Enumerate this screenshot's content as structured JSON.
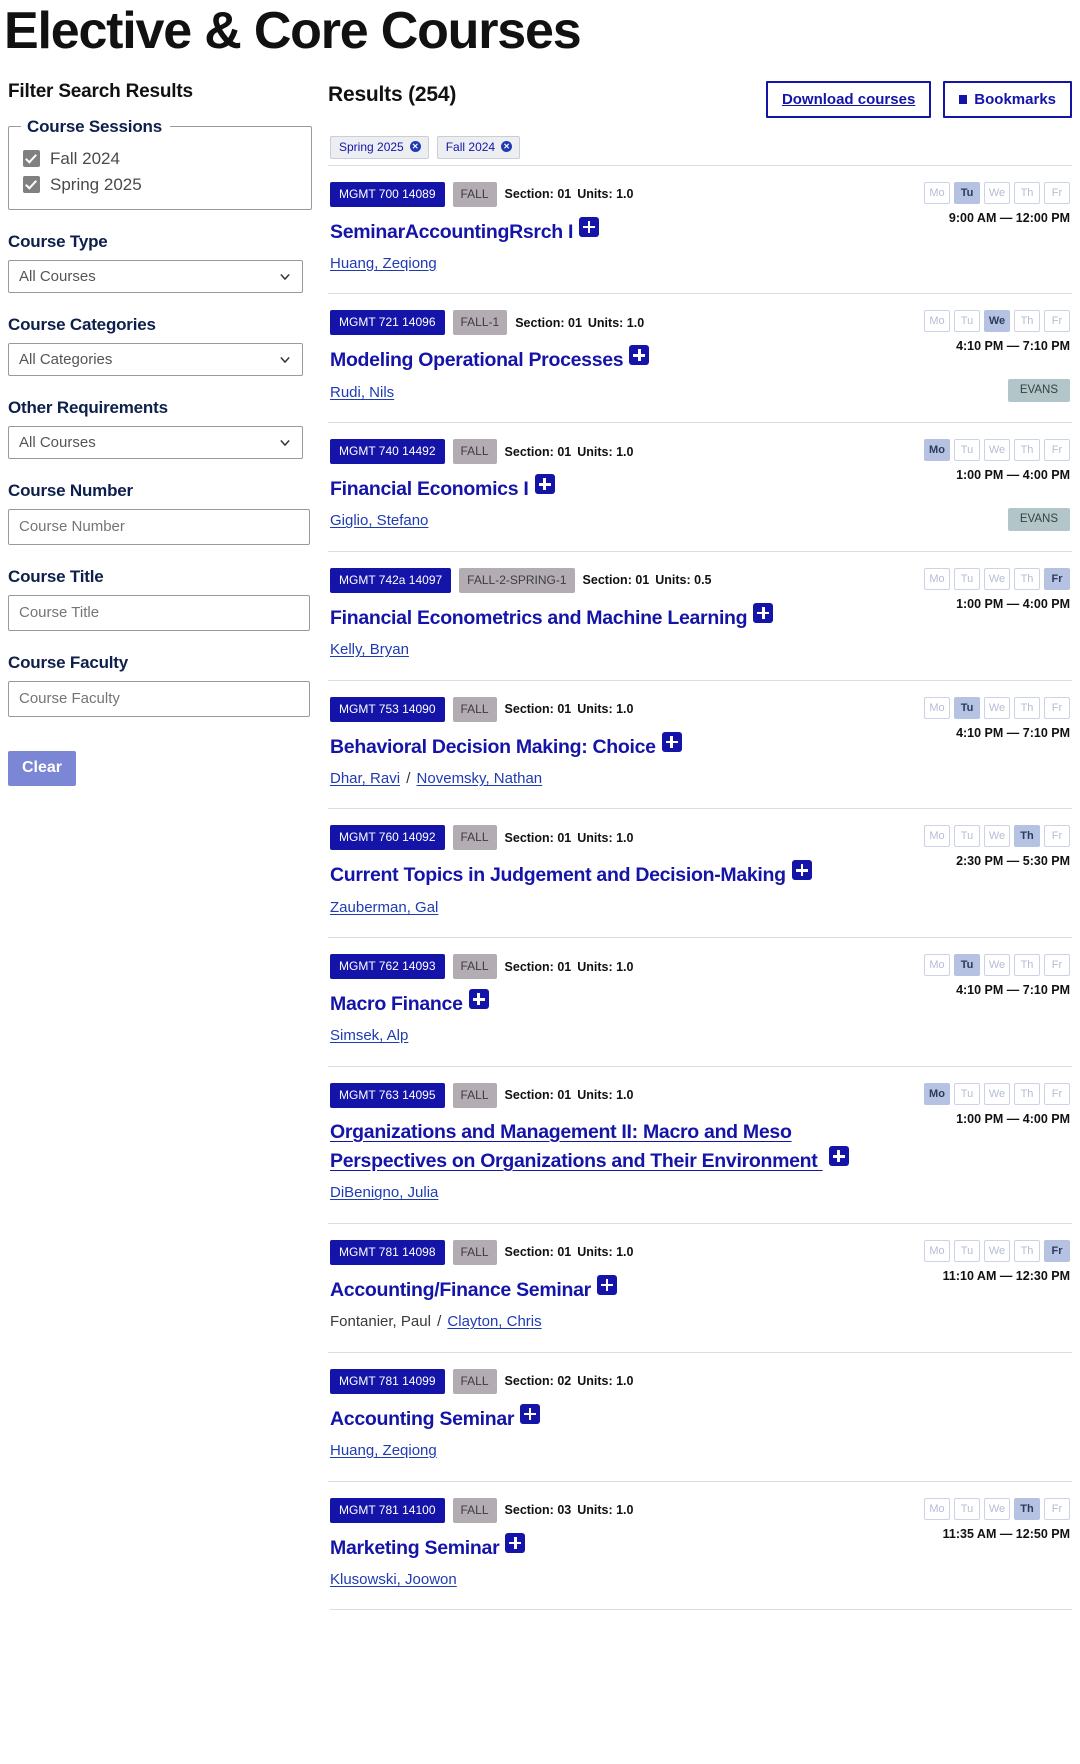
{
  "page_title": "Elective & Core Courses",
  "colors": {
    "brand_blue": "#1414a8",
    "navy": "#0d1f4a",
    "clear_button": "#7b87d4",
    "day_active": "#b6c2e2",
    "location_badge": "#b2c6c9",
    "term_badge": "#b3adb3"
  },
  "sidebar": {
    "heading": "Filter Search Results",
    "sessions": {
      "legend": "Course Sessions",
      "options": [
        {
          "label": "Fall 2024",
          "checked": true
        },
        {
          "label": "Spring 2025",
          "checked": true
        }
      ]
    },
    "course_type": {
      "label": "Course Type",
      "value": "All Courses"
    },
    "course_categories": {
      "label": "Course Categories",
      "value": "All Categories"
    },
    "other_requirements": {
      "label": "Other Requirements",
      "value": "All Courses"
    },
    "course_number": {
      "label": "Course Number",
      "placeholder": "Course Number",
      "value": ""
    },
    "course_title": {
      "label": "Course Title",
      "placeholder": "Course Title",
      "value": ""
    },
    "course_faculty": {
      "label": "Course Faculty",
      "placeholder": "Course Faculty",
      "value": ""
    },
    "clear_label": "Clear"
  },
  "results": {
    "count_label": "Results (254)",
    "download_label": "Download courses",
    "bookmarks_label": "Bookmarks",
    "chips": [
      {
        "label": "Spring 2025"
      },
      {
        "label": "Fall 2024"
      }
    ],
    "day_labels": [
      "Mo",
      "Tu",
      "We",
      "Th",
      "Fr"
    ],
    "courses": [
      {
        "code": "MGMT 700 14089",
        "term": "FALL",
        "section": "Section: 01",
        "units": "Units: 1.0",
        "title": "SeminarAccountingRsrch I",
        "title_underlined": false,
        "faculty": [
          {
            "name": "Huang, Zeqiong",
            "link": true
          }
        ],
        "days": [
          "Tu"
        ],
        "time": "9:00 AM — 12:00 PM",
        "location": ""
      },
      {
        "code": "MGMT 721 14096",
        "term": "FALL-1",
        "section": "Section: 01",
        "units": "Units: 1.0",
        "title": "Modeling Operational Processes",
        "title_underlined": false,
        "faculty": [
          {
            "name": "Rudi, Nils",
            "link": true
          }
        ],
        "days": [
          "We"
        ],
        "time": "4:10 PM — 7:10 PM",
        "location": "EVANS"
      },
      {
        "code": "MGMT 740 14492",
        "term": "FALL",
        "section": "Section: 01",
        "units": "Units: 1.0",
        "title": "Financial Economics I",
        "title_underlined": false,
        "faculty": [
          {
            "name": "Giglio, Stefano",
            "link": true
          }
        ],
        "days": [
          "Mo"
        ],
        "time": "1:00 PM — 4:00 PM",
        "location": "EVANS"
      },
      {
        "code": "MGMT 742a 14097",
        "term": "FALL-2-SPRING-1",
        "section": "Section: 01",
        "units": "Units: 0.5",
        "title": "Financial Econometrics and Machine Learning",
        "title_underlined": false,
        "faculty": [
          {
            "name": "Kelly, Bryan",
            "link": true
          }
        ],
        "days": [
          "Fr"
        ],
        "time": "1:00 PM — 4:00 PM",
        "location": ""
      },
      {
        "code": "MGMT 753 14090",
        "term": "FALL",
        "section": "Section: 01",
        "units": "Units: 1.0",
        "title": "Behavioral Decision Making: Choice",
        "title_underlined": false,
        "faculty": [
          {
            "name": "Dhar, Ravi",
            "link": true
          },
          {
            "name": "Novemsky, Nathan",
            "link": true
          }
        ],
        "days": [
          "Tu"
        ],
        "time": "4:10 PM — 7:10 PM",
        "location": ""
      },
      {
        "code": "MGMT 760 14092",
        "term": "FALL",
        "section": "Section: 01",
        "units": "Units: 1.0",
        "title": "Current Topics in Judgement and Decision-Making",
        "title_underlined": false,
        "faculty": [
          {
            "name": "Zauberman, Gal",
            "link": true
          }
        ],
        "days": [
          "Th"
        ],
        "time": "2:30 PM — 5:30 PM",
        "location": ""
      },
      {
        "code": "MGMT 762 14093",
        "term": "FALL",
        "section": "Section: 01",
        "units": "Units: 1.0",
        "title": "Macro Finance",
        "title_underlined": false,
        "faculty": [
          {
            "name": "Simsek, Alp",
            "link": true
          }
        ],
        "days": [
          "Tu"
        ],
        "time": "4:10 PM — 7:10 PM",
        "location": ""
      },
      {
        "code": "MGMT 763 14095",
        "term": "FALL",
        "section": "Section: 01",
        "units": "Units: 1.0",
        "title": "Organizations and Management II: Macro and Meso Perspectives on Organizations and Their Environment ",
        "title_underlined": true,
        "faculty": [
          {
            "name": "DiBenigno, Julia",
            "link": true
          }
        ],
        "days": [
          "Mo"
        ],
        "time": "1:00 PM — 4:00 PM",
        "location": ""
      },
      {
        "code": "MGMT 781 14098",
        "term": "FALL",
        "section": "Section: 01",
        "units": "Units: 1.0",
        "title": "Accounting/Finance Seminar",
        "title_underlined": false,
        "faculty": [
          {
            "name": "Fontanier, Paul",
            "link": false
          },
          {
            "name": "Clayton, Chris",
            "link": true
          }
        ],
        "days": [
          "Fr"
        ],
        "time": "11:10 AM — 12:30 PM",
        "location": ""
      },
      {
        "code": "MGMT 781 14099",
        "term": "FALL",
        "section": "Section: 02",
        "units": "Units: 1.0",
        "title": "Accounting Seminar",
        "title_underlined": false,
        "faculty": [
          {
            "name": "Huang, Zeqiong",
            "link": true
          }
        ],
        "days": [],
        "time": "",
        "location": ""
      },
      {
        "code": "MGMT 781 14100",
        "term": "FALL",
        "section": "Section: 03",
        "units": "Units: 1.0",
        "title": "Marketing Seminar",
        "title_underlined": false,
        "faculty": [
          {
            "name": "Klusowski, Joowon",
            "link": true
          }
        ],
        "days": [
          "Th"
        ],
        "time": "11:35 AM — 12:50 PM",
        "location": ""
      }
    ]
  }
}
